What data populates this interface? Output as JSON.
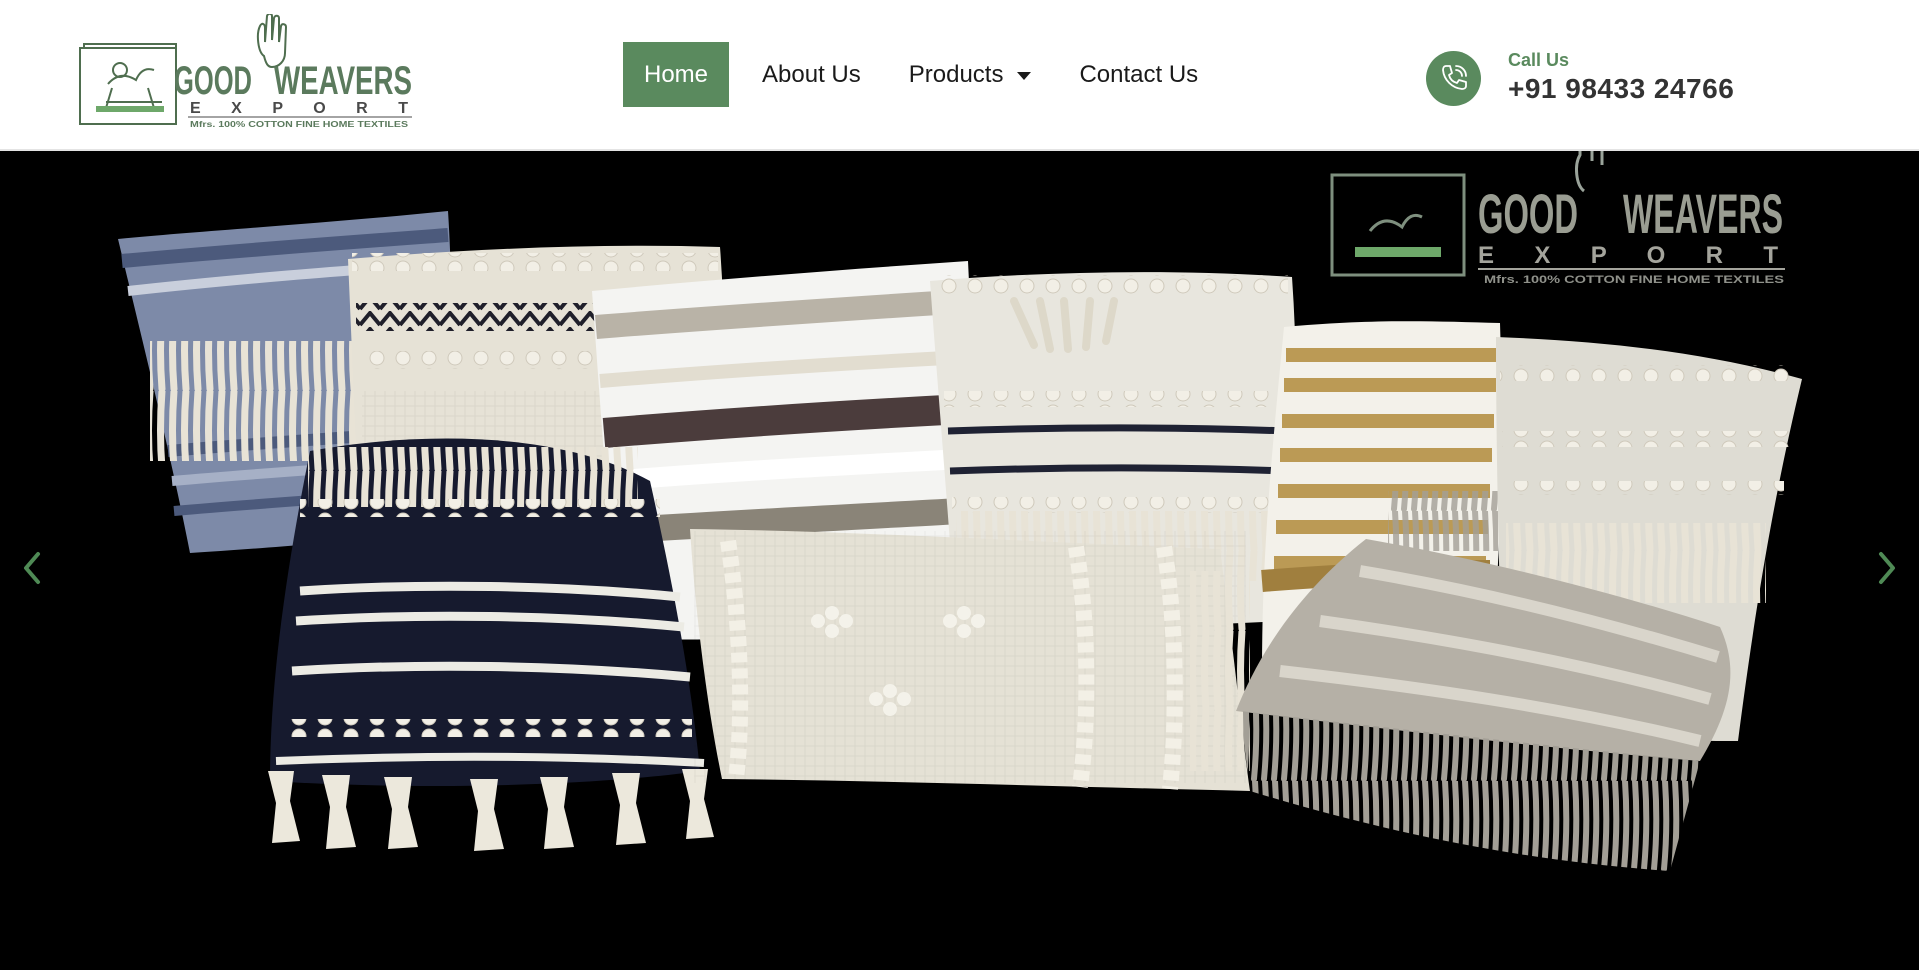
{
  "brand": {
    "logo_main": "GOOD WEAVERS",
    "logo_sub": "E X P O R T",
    "logo_tagline": "Mfrs. 100% COTTON FINE HOME TEXTILES"
  },
  "nav": {
    "items": [
      {
        "label": "Home",
        "active": true
      },
      {
        "label": "About Us",
        "active": false
      },
      {
        "label": "Products",
        "active": false,
        "dropdown": true
      },
      {
        "label": "Contact Us",
        "active": false
      }
    ]
  },
  "contact": {
    "label": "Call Us",
    "phone": "+91 98433 24766",
    "icon": "phone-icon"
  },
  "hero": {
    "watermark_main": "GOOD WEAVERS",
    "watermark_sub": "E X P O R T",
    "watermark_tagline": "Mfrs. 100% COTTON FINE HOME TEXTILES",
    "prev_icon": "chevron-left-icon",
    "next_icon": "chevron-right-icon"
  },
  "colors": {
    "accent": "#5a8a5e",
    "text_dark": "#1a1a1a",
    "phone_text": "#333333",
    "hero_bg": "#000000"
  }
}
